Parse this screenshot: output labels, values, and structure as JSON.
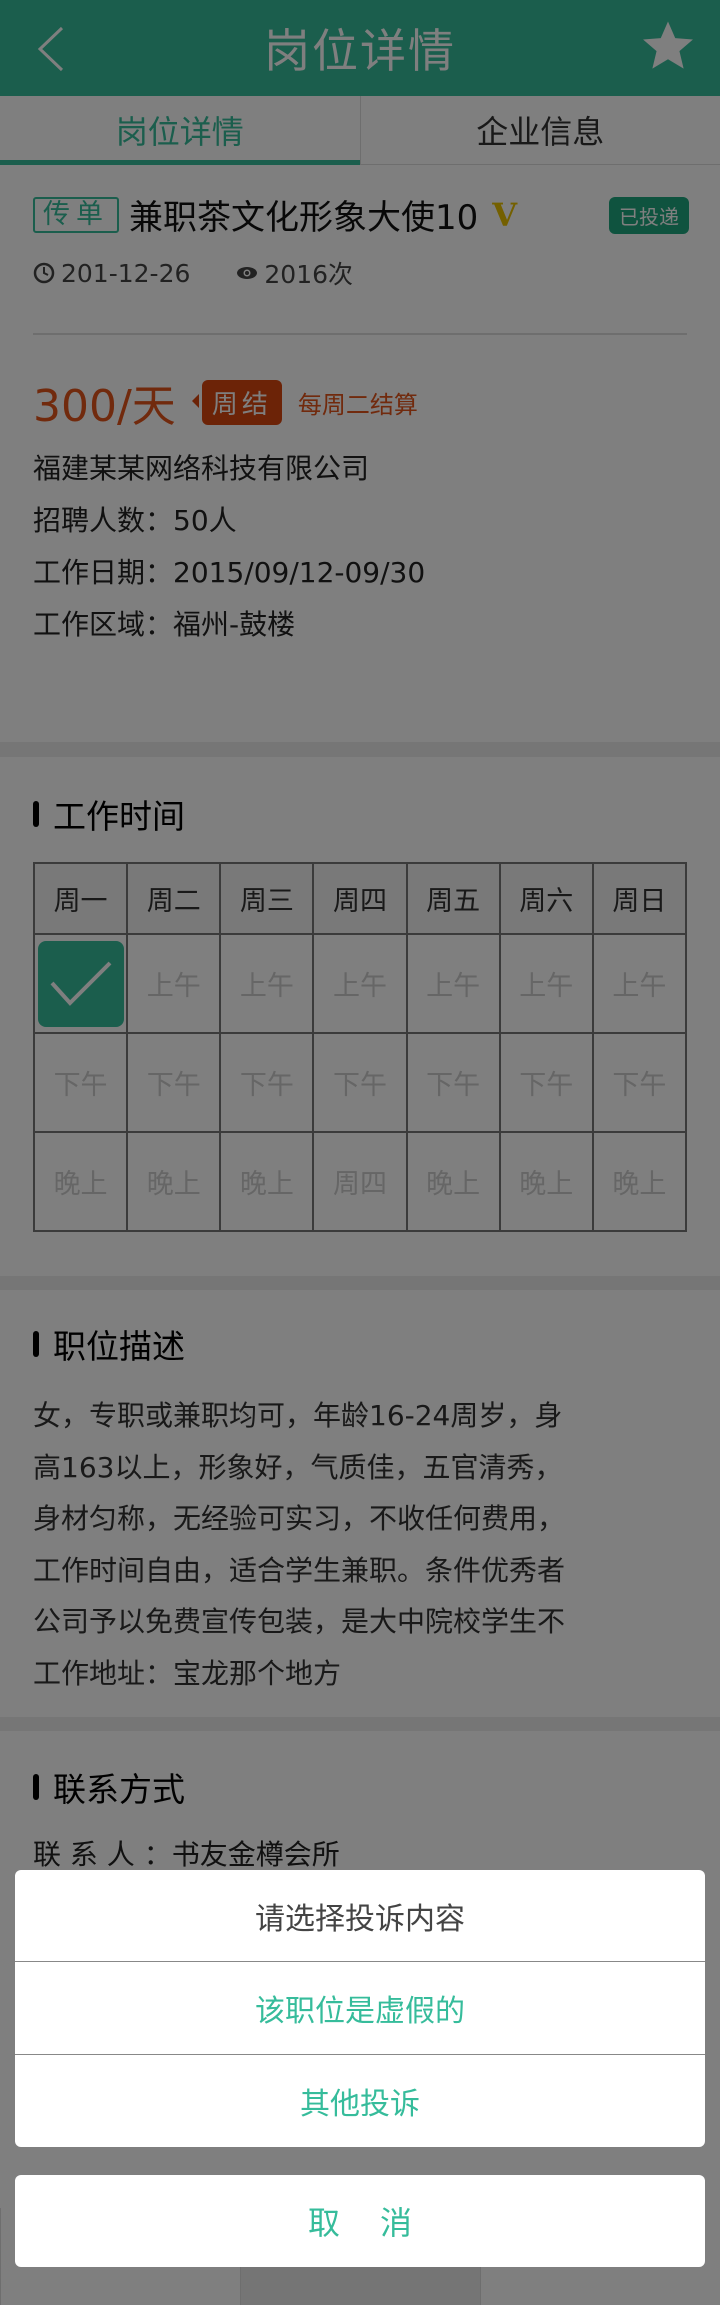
{
  "header": {
    "title": "岗位详情",
    "back_icon": "chevron-left-icon",
    "star_icon": "star-icon"
  },
  "tabs": [
    {
      "label": "岗位详情",
      "active": true
    },
    {
      "label": "企业信息",
      "active": false
    }
  ],
  "job": {
    "tag": "传单",
    "title": "兼职茶文化形象大使10",
    "verified": "V",
    "status": "已投递",
    "date": "201-12-26",
    "views": "2016次",
    "salary": "300/天",
    "pay_cycle": "周结",
    "pay_note": "每周二结算",
    "company": "福建某某网络科技有限公司",
    "headcount": "招聘人数：50人",
    "work_date": "工作日期：2015/09/12-09/30",
    "area": "工作区域：福州-鼓楼"
  },
  "schedule": {
    "title": "工作时间",
    "days": [
      "周一",
      "周二",
      "周三",
      "周四",
      "周五",
      "周六",
      "周日"
    ],
    "rows": [
      [
        "",
        "上午",
        "上午",
        "上午",
        "上午",
        "上午",
        "上午"
      ],
      [
        "下午",
        "下午",
        "下午",
        "下午",
        "下午",
        "下午",
        "下午"
      ],
      [
        "晚上",
        "晚上",
        "晚上",
        "周四",
        "晚上",
        "晚上",
        "晚上"
      ]
    ],
    "selected": [
      [
        0,
        0
      ]
    ]
  },
  "description": {
    "title": "职位描述",
    "lines": [
      "女，专职或兼职均可，年龄16-24周岁，身",
      "高163以上，形象好，气质佳，五官清秀，",
      "身材匀称，无经验可实习，不收任何费用，",
      "工作时间自由，适合学生兼职。条件优秀者",
      "公司予以免费宣传包装，是大中院校学生不",
      "工作地址：宝龙那个地方"
    ]
  },
  "contact": {
    "title": "联系方式",
    "person": "联 系 人 ：书友金樽会所"
  },
  "dialog": {
    "title": "请选择投诉内容",
    "options": [
      "该职位是虚假的",
      "其他投诉"
    ],
    "cancel": "取消"
  },
  "colors": {
    "accent": "#36bc9b",
    "price": "#e2541a"
  }
}
